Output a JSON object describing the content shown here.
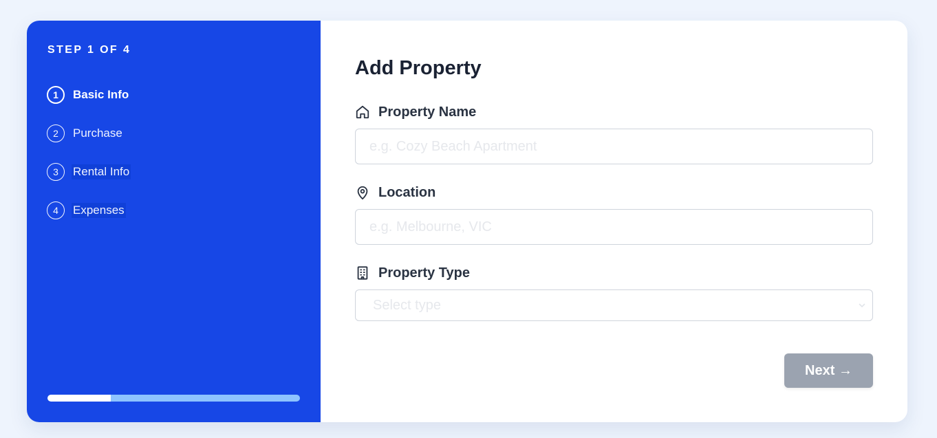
{
  "sidebar": {
    "step_counter": "STEP 1 OF 4",
    "steps": [
      {
        "num": "1",
        "label": "Basic Info",
        "active": true
      },
      {
        "num": "2",
        "label": "Purchase",
        "active": false
      },
      {
        "num": "3",
        "label": "Rental Info",
        "active": false
      },
      {
        "num": "4",
        "label": "Expenses",
        "active": false
      }
    ],
    "progress": 0.25
  },
  "form": {
    "title": "Add Property",
    "property_name": {
      "label": "Property Name",
      "placeholder": "e.g. Cozy Beach Apartment",
      "value": "",
      "icon": "home-icon"
    },
    "location": {
      "label": "Location",
      "placeholder": "e.g. Melbourne, VIC",
      "value": "",
      "icon": "map-pin-icon"
    },
    "property_type": {
      "label": "Property Type",
      "selected": "Select type",
      "icon": "building-icon"
    },
    "next_label": "Next →"
  },
  "colors": {
    "sidebar_bg": "#1747e6",
    "progress_track": "#8ec3ff",
    "progress_fill": "#ffffff",
    "next_button_disabled": "#9ba3b0"
  }
}
